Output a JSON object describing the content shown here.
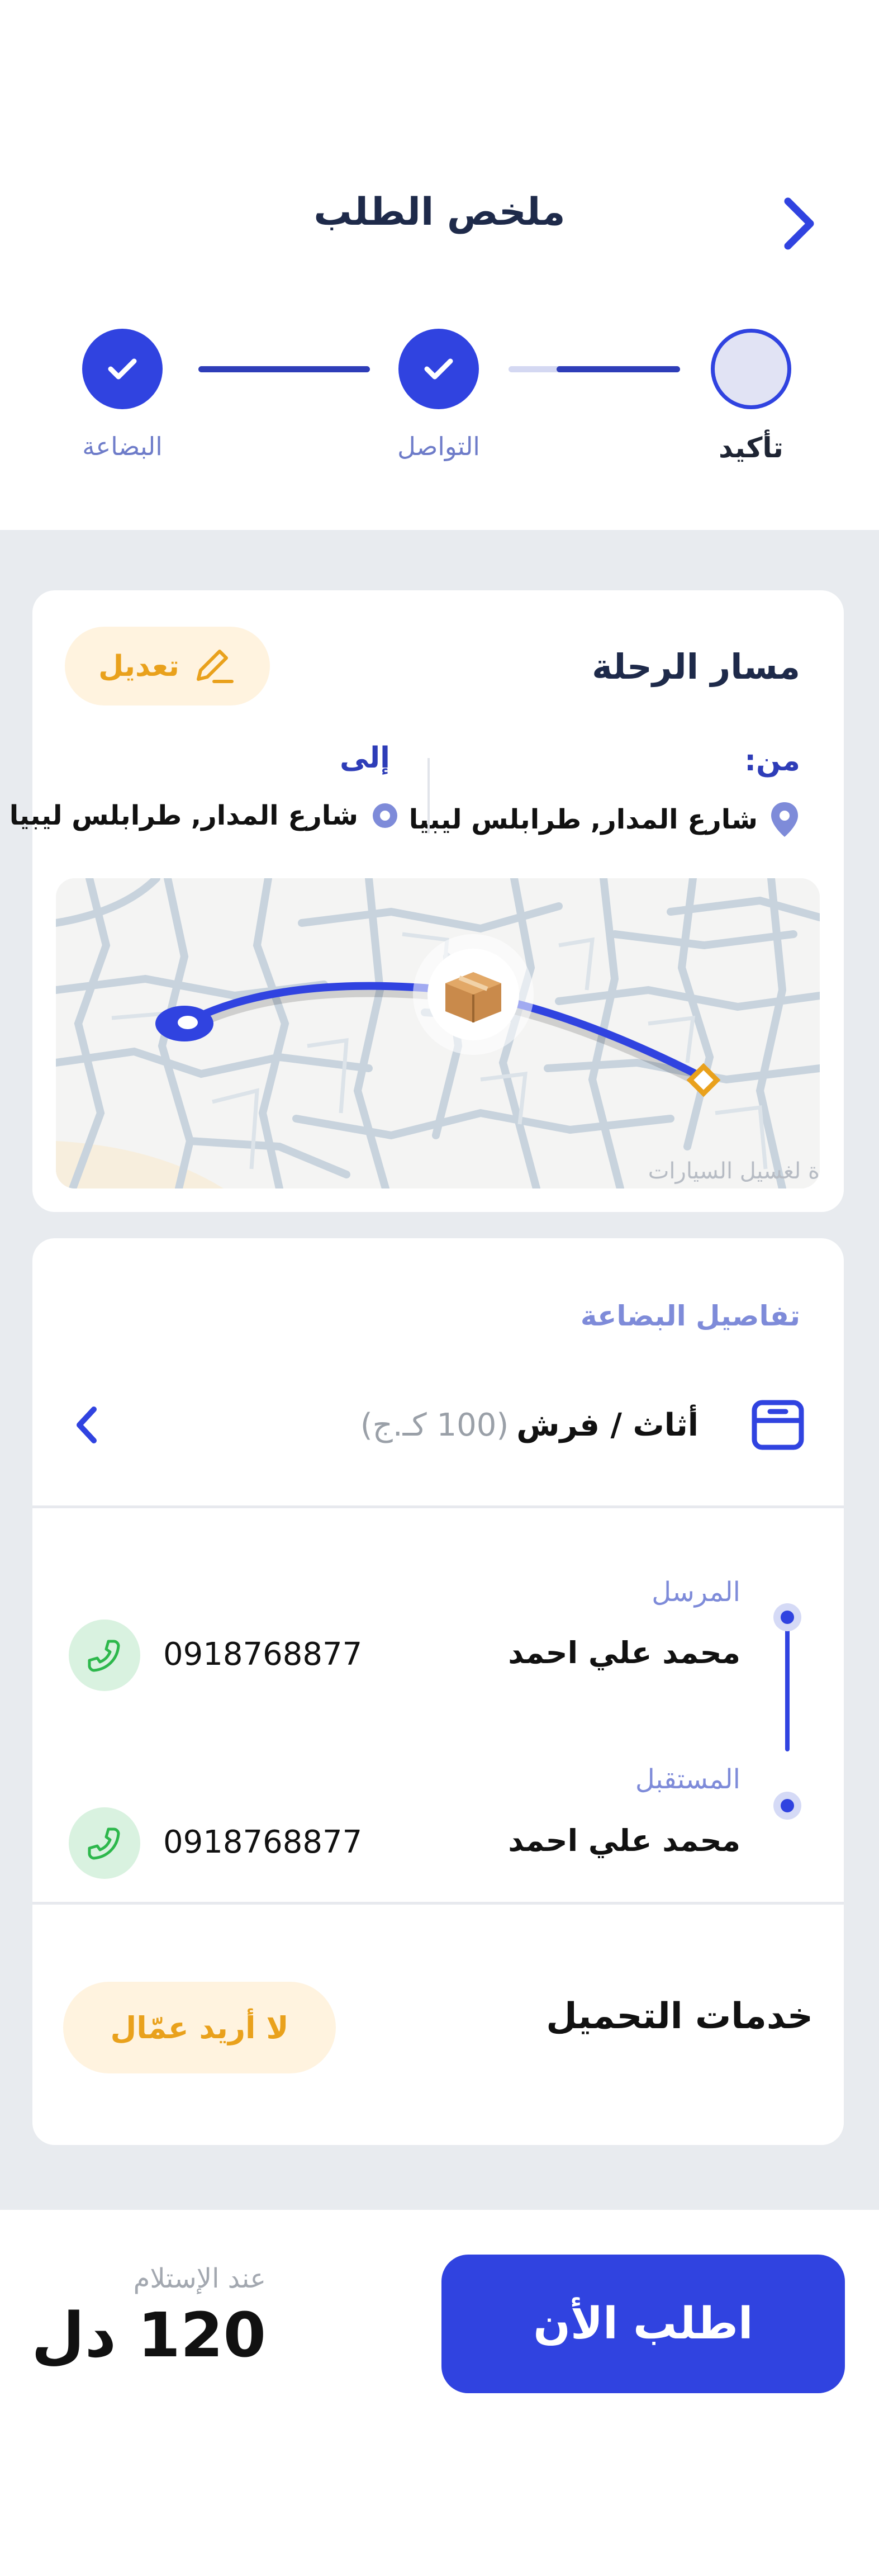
{
  "header": {
    "title": "ملخص الطلب",
    "steps": [
      {
        "label": "تأكيد",
        "state": "current"
      },
      {
        "label": "التواصل",
        "state": "done"
      },
      {
        "label": "البضاعة",
        "state": "done"
      }
    ],
    "progress_fraction": 0.72
  },
  "route_card": {
    "title": "مسار الرحلة",
    "edit_label": "تعديل",
    "from_label": "من:",
    "from_address": "شارع المدار, طرابلس ليبيا",
    "to_label": "إلى",
    "to_address": "شارع المدار, طرابلس ليبيا",
    "map_watermark": "ة لغسيل السيارات"
  },
  "goods_card": {
    "title": "تفاصيل البضاعة",
    "item_name": "أثاث / فرش",
    "item_weight": "(100 كـ.ج)",
    "sender_label": "المرسل",
    "sender_name": "محمد علي احمد",
    "sender_phone": "0918768877",
    "receiver_label": "المستقبل",
    "receiver_name": "محمد علي احمد",
    "receiver_phone": "0918768877",
    "loading_title": "خدمات التحميل",
    "loading_value": "لا أريد عمّال"
  },
  "footer": {
    "on_receipt_label": "عند الإستلام",
    "price": "120 دل",
    "order_button": "اطلب الأن"
  },
  "colors": {
    "primary": "#3043E0",
    "accent_yellow": "#E9A11C",
    "phone_green": "#2DB84C",
    "muted_blue": "#7E8BD9"
  }
}
